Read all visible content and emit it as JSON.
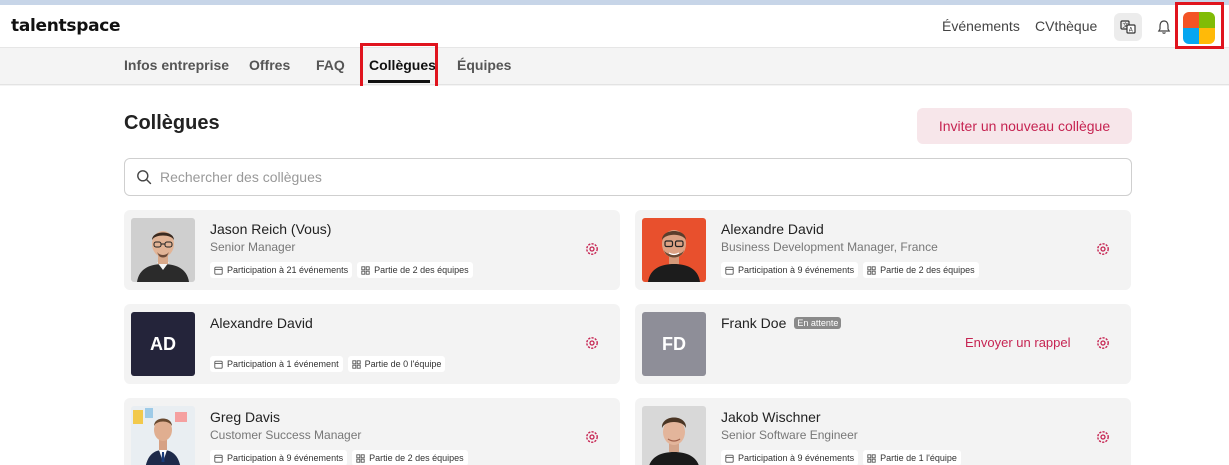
{
  "header": {
    "logo": "talentspace",
    "nav": [
      {
        "label": "Événements"
      },
      {
        "label": "CVthèque"
      }
    ]
  },
  "tabs": [
    {
      "label": "Infos entreprise",
      "active": false
    },
    {
      "label": "Offres",
      "active": false
    },
    {
      "label": "FAQ",
      "active": false
    },
    {
      "label": "Collègues",
      "active": true
    },
    {
      "label": "Équipes",
      "active": false
    }
  ],
  "page": {
    "title": "Collègues",
    "invite_label": "Inviter un nouveau collègue",
    "search_placeholder": "Rechercher des collègues",
    "search_value": ""
  },
  "colleagues": [
    {
      "name": "Jason Reich (Vous)",
      "role": "Senior Manager",
      "events": "Participation à 21 événements",
      "teams": "Partie de 2 des équipes",
      "avatar": "photo"
    },
    {
      "name": "Alexandre David",
      "role": "Business Development Manager, France",
      "events": "Participation à 9 événements",
      "teams": "Partie de 2 des équipes",
      "avatar": "photo"
    },
    {
      "name": "Alexandre David",
      "role": "",
      "events": "Participation à 1 événement",
      "teams": "Partie de 0 l'équipe",
      "avatar": "initials",
      "initials": "AD"
    },
    {
      "name": "Frank Doe",
      "role": "",
      "badge": "En attente",
      "action": "Envoyer un rappel",
      "avatar": "initials",
      "initials": "FD"
    },
    {
      "name": "Greg Davis",
      "role": "Customer Success Manager",
      "events": "Participation à 9 événements",
      "teams": "Partie de 2 des équipes",
      "avatar": "photo"
    },
    {
      "name": "Jakob Wischner",
      "role": "Senior Software Engineer",
      "events": "Participation à 9 événements",
      "teams": "Partie de 1 l'équipe",
      "avatar": "photo"
    }
  ],
  "colors": {
    "accent": "#c62452",
    "highlight": "#e0141e",
    "initials_dark": "#24243a",
    "initials_grey": "#8e8e98"
  }
}
